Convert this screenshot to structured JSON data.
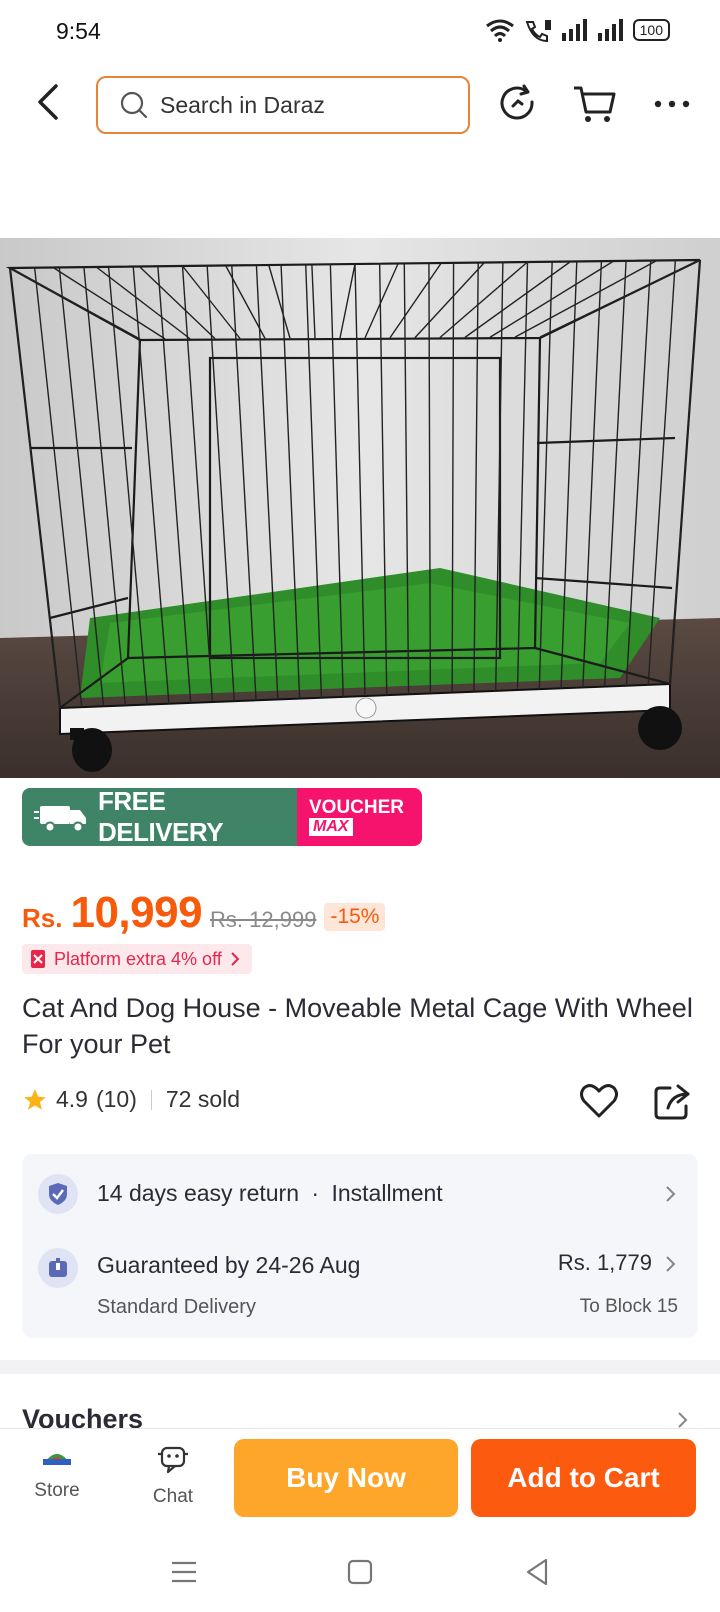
{
  "status_bar": {
    "time": "9:54",
    "battery": "100"
  },
  "header": {
    "search_placeholder": "Search in Daraz"
  },
  "banner": {
    "free_badge": "FREE",
    "free_label": "FREE DELIVERY",
    "voucher_line1": "VOUCHER",
    "voucher_line2": "MAX"
  },
  "price": {
    "currency": "Rs.",
    "value": "10,999",
    "original": "Rs. 12,999",
    "discount": "-15%"
  },
  "platform_offer": "Platform extra 4% off",
  "product": {
    "title": "Cat And Dog House - Moveable Metal Cage With Wheel For your Pet",
    "rating": "4.9",
    "reviews": "(10)",
    "sold": "72 sold"
  },
  "info": {
    "return_text": "14 days easy return",
    "separator": "·",
    "installment": "Installment",
    "delivery_main": "Guaranteed by 24-26 Aug",
    "delivery_sub": "Standard Delivery",
    "delivery_fee": "Rs. 1,779",
    "delivery_location": "To Block 15"
  },
  "vouchers_title": "Vouchers",
  "bottom_bar": {
    "store_label": "Store",
    "chat_label": "Chat",
    "buy_now": "Buy Now",
    "add_to_cart": "Add to Cart"
  },
  "colors": {
    "accent": "#f75a0a",
    "buy_now": "#fea62a",
    "add_to_cart": "#fb5a0f",
    "free_delivery": "#3f8467",
    "voucher": "#f5136e"
  }
}
